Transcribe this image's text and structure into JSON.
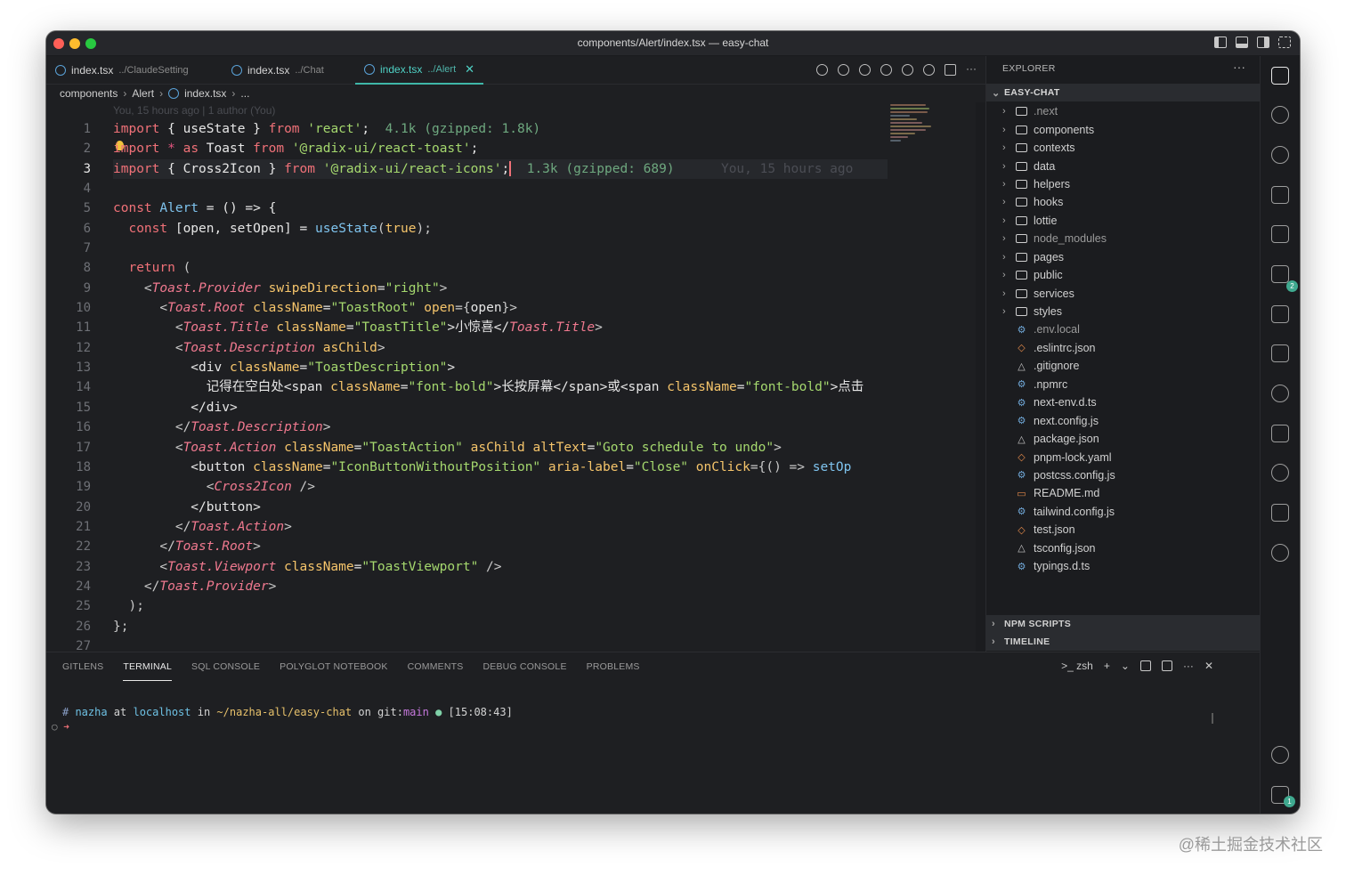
{
  "window": {
    "title": "components/Alert/index.tsx — easy-chat"
  },
  "tabs": [
    {
      "name": "index.tsx",
      "path": "../ClaudeSetting"
    },
    {
      "name": "index.tsx",
      "path": "../Chat"
    },
    {
      "name": "index.tsx",
      "path": "../Alert"
    }
  ],
  "breadcrumb": {
    "part1": "components",
    "part2": "Alert",
    "part3": "index.tsx",
    "part4": "..."
  },
  "blame": {
    "top": "You, 15 hours ago | 1 author (You)",
    "inline": "You, 15 hours ago"
  },
  "line_numbers": [
    "1",
    "2",
    "3",
    "4",
    "5",
    "6",
    "7",
    "8",
    "9",
    "10",
    "11",
    "12",
    "13",
    "14",
    "15",
    "16",
    "17",
    "18",
    "19",
    "20",
    "21",
    "22",
    "23",
    "24",
    "25",
    "26",
    "27"
  ],
  "code": {
    "l1": {
      "a": "import",
      "b": " { useState } ",
      "c": "from",
      "d": " 'react'",
      "e": ";",
      "f": "  4.1k (gzipped: 1.8k)"
    },
    "l2": {
      "a": "import",
      "b": " * ",
      "c": "as",
      "d": " Toast ",
      "e": "from",
      "f": " '@radix-ui/react-toast'",
      "g": ";"
    },
    "l3": {
      "a": "import",
      "b": " { Cross2Icon } ",
      "c": "from",
      "d": " '@radix-ui/react-icons'",
      "e": ";",
      "f": "  1.3k (gzipped: 689)"
    },
    "l5": {
      "a": "const ",
      "b": "Alert",
      "c": " = () => {"
    },
    "l6": {
      "a": "  const ",
      "b": "[open, setOpen]",
      "c": " = ",
      "d": "useState",
      "e": "(",
      "f": "true",
      "g": ");"
    },
    "l8": {
      "a": "  return",
      "b": " ("
    },
    "l9": {
      "a": "    <",
      "b": "Toast.Provider",
      "c": " swipeDirection",
      "d": "=",
      "e": "\"right\"",
      "f": ">"
    },
    "l10": {
      "a": "      <",
      "b": "Toast.Root",
      "c": " className",
      "d": "=",
      "e": "\"ToastRoot\"",
      "f": " open",
      "g": "={",
      "h": "open",
      "i": "}>"
    },
    "l11": {
      "a": "        <",
      "b": "Toast.Title",
      "c": " className",
      "d": "=",
      "e": "\"ToastTitle\"",
      "f": ">小惊喜</",
      "g": "Toast.Title",
      "h": ">"
    },
    "l12": {
      "a": "        <",
      "b": "Toast.Description",
      "c": " asChild",
      "d": ">"
    },
    "l13": {
      "a": "          <div",
      "b": " className",
      "c": "=",
      "d": "\"ToastDescription\"",
      "e": ">"
    },
    "l14": {
      "a": "            记得在空白处<span",
      "b": " className",
      "c": "=",
      "d": "\"font-bold\"",
      "e": ">长按屏幕</span>或<span",
      "f": " className",
      "g": "=",
      "h": "\"font-bold\"",
      "i": ">点击"
    },
    "l15": {
      "a": "          </div>"
    },
    "l16": {
      "a": "        </",
      "b": "Toast.Description",
      "c": ">"
    },
    "l17": {
      "a": "        <",
      "b": "Toast.Action",
      "c": " className",
      "d": "=",
      "e": "\"ToastAction\"",
      "f": " asChild",
      "g": " altText",
      "h": "=",
      "i": "\"Goto schedule to undo\"",
      "j": ">"
    },
    "l18": {
      "a": "          <button",
      "b": " className",
      "c": "=",
      "d": "\"IconButtonWithoutPosition\"",
      "e": " aria-label",
      "f": "=",
      "g": "\"Close\"",
      "h": " onClick",
      "i": "={() => ",
      "j": "setOp"
    },
    "l19": {
      "a": "            <",
      "b": "Cross2Icon",
      "c": " />"
    },
    "l20": {
      "a": "          </button>"
    },
    "l21": {
      "a": "        </",
      "b": "Toast.Action",
      "c": ">"
    },
    "l22": {
      "a": "      </",
      "b": "Toast.Root",
      "c": ">"
    },
    "l23": {
      "a": "      <",
      "b": "Toast.Viewport",
      "c": " className",
      "d": "=",
      "e": "\"ToastViewport\"",
      "f": " />"
    },
    "l24": {
      "a": "    </",
      "b": "Toast.Provider",
      "c": ">"
    },
    "l25": {
      "a": "  );"
    },
    "l26": {
      "a": "};"
    }
  },
  "explorer": {
    "title": "EXPLORER",
    "root": "EASY-CHAT",
    "folders": [
      "next",
      "components",
      "contexts",
      "data",
      "helpers",
      "hooks",
      "lottie",
      "node_modules",
      "pages",
      "public",
      "services",
      "styles"
    ],
    "folder_first": ".next",
    "files": [
      ".env.local",
      ".eslintrc.json",
      ".gitignore",
      ".npmrc",
      "next-env.d.ts",
      "next.config.js",
      "package.json",
      "pnpm-lock.yaml",
      "postcss.config.js",
      "README.md",
      "tailwind.config.js",
      "test.json",
      "tsconfig.json",
      "typings.d.ts"
    ],
    "sections": [
      "NPM SCRIPTS",
      "TIMELINE"
    ]
  },
  "activity_badges": {
    "extensions": "2",
    "accounts_bottom": "1"
  },
  "panel": {
    "tabs": [
      "GITLENS",
      "TERMINAL",
      "SQL CONSOLE",
      "POLYGLOT NOTEBOOK",
      "COMMENTS",
      "DEBUG CONSOLE",
      "PROBLEMS"
    ],
    "shell": "zsh",
    "prompt": {
      "hash": "# ",
      "user": "nazha",
      "at": " at ",
      "host": "localhost",
      "in": " in ",
      "path": "~/nazha-all/easy-chat",
      "on": " on ",
      "git": "git:",
      "branch": "main",
      "dot": " ● ",
      "time": "[15:08:43]"
    },
    "prompt2": "○ ",
    "arrow": "➜"
  },
  "watermark": "@稀土掘金技术社区"
}
